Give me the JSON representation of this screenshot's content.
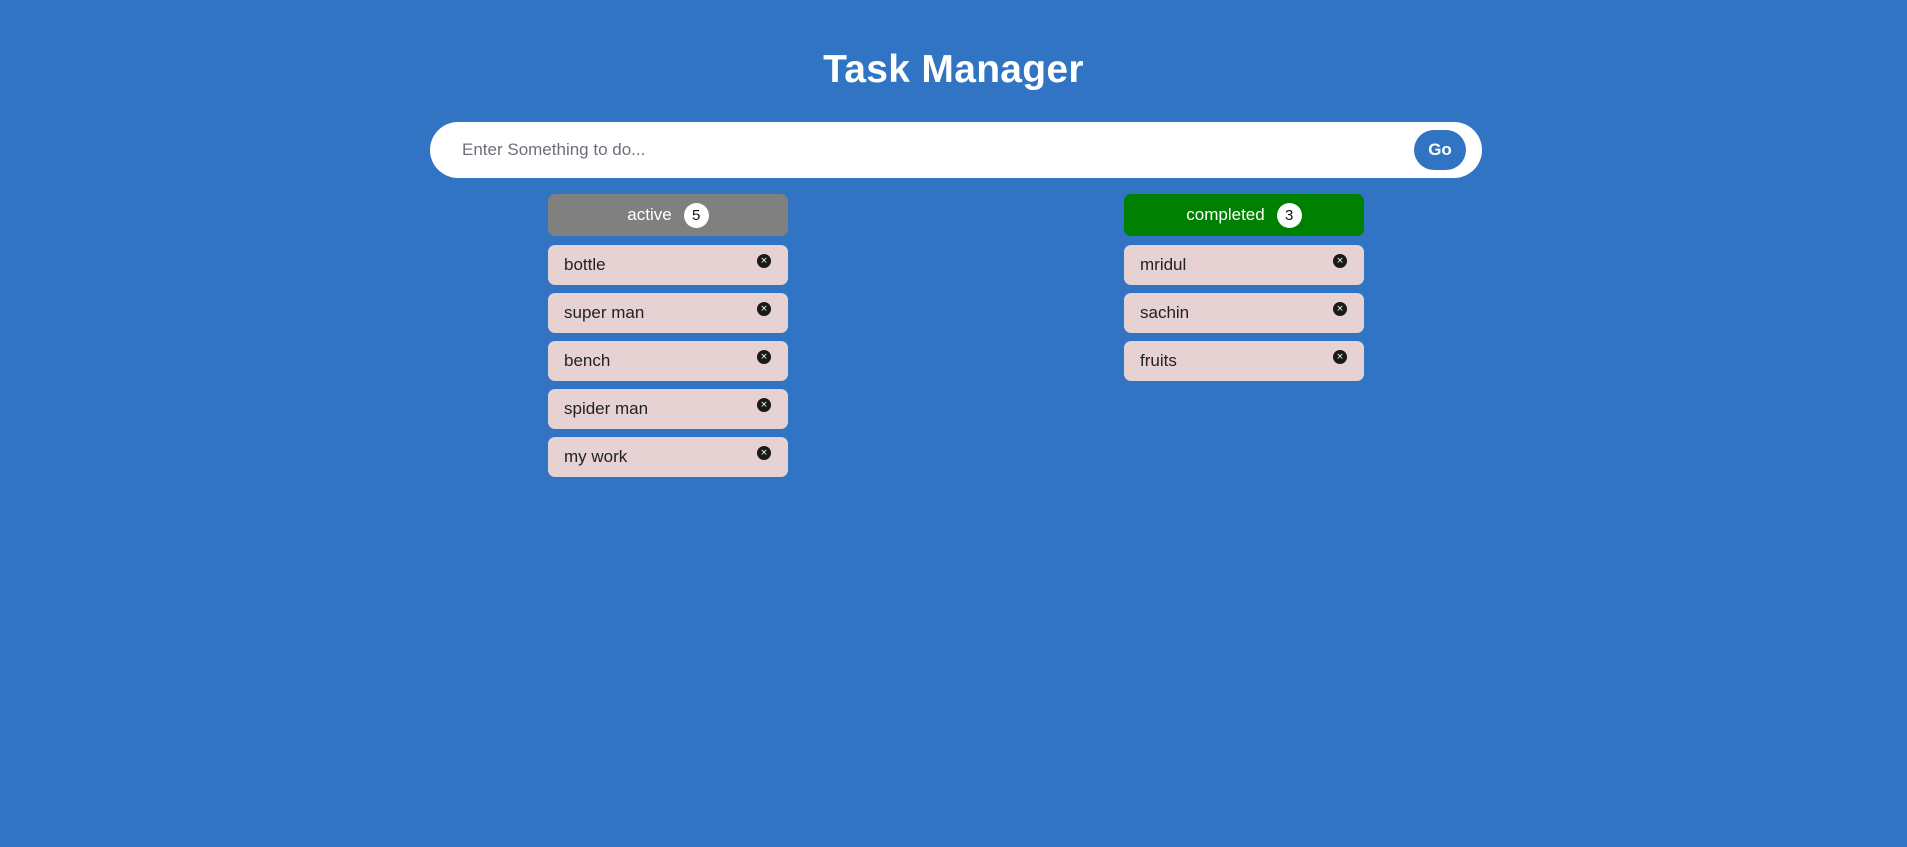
{
  "app": {
    "title": "Task Manager"
  },
  "input": {
    "placeholder": "Enter Something to do...",
    "value": "",
    "submit_label": "Go"
  },
  "columns": {
    "active": {
      "label": "active",
      "count": "5",
      "color": "#808080",
      "items": [
        {
          "text": "bottle",
          "remove_icon": "×"
        },
        {
          "text": "super man",
          "remove_icon": "×"
        },
        {
          "text": "bench",
          "remove_icon": "×"
        },
        {
          "text": "spider man",
          "remove_icon": "×"
        },
        {
          "text": "my work",
          "remove_icon": "×"
        }
      ]
    },
    "completed": {
      "label": "completed",
      "count": "3",
      "color": "#008000",
      "items": [
        {
          "text": "mridul",
          "remove_icon": "×"
        },
        {
          "text": "sachin",
          "remove_icon": "×"
        },
        {
          "text": "fruits",
          "remove_icon": "×"
        }
      ]
    }
  },
  "theme": {
    "background": "#3274c4",
    "item_background": "#e6d2d2"
  }
}
